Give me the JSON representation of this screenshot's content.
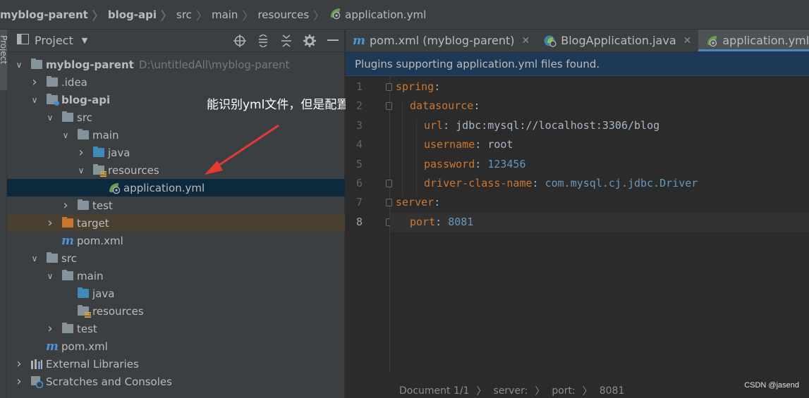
{
  "breadcrumb": [
    "myblog-parent",
    "blog-api",
    "src",
    "main",
    "resources",
    "application.yml"
  ],
  "side_stripe": {
    "label": "Project"
  },
  "project_panel": {
    "title": "Project",
    "tools": [
      "locate-icon",
      "expand-all-icon",
      "collapse-all-icon",
      "settings-icon",
      "hide-icon"
    ]
  },
  "tree": [
    {
      "label": "myblog-parent",
      "path": "D:\\untitledAll\\myblog-parent",
      "bold": true,
      "arrow": "down",
      "icon": "folder",
      "depth": 0
    },
    {
      "label": ".idea",
      "arrow": "right",
      "icon": "folder",
      "depth": 1
    },
    {
      "label": "blog-api",
      "bold": true,
      "arrow": "down",
      "icon": "folder-module",
      "depth": 1
    },
    {
      "label": "src",
      "arrow": "down",
      "icon": "folder",
      "depth": 2
    },
    {
      "label": "main",
      "arrow": "down",
      "icon": "folder",
      "depth": 3
    },
    {
      "label": "java",
      "arrow": "right",
      "icon": "folder-blue",
      "depth": 4
    },
    {
      "label": "resources",
      "arrow": "down",
      "icon": "folder-resources",
      "depth": 4
    },
    {
      "label": "application.yml",
      "arrow": "",
      "icon": "spring",
      "depth": 5,
      "selected": true
    },
    {
      "label": "test",
      "arrow": "right",
      "icon": "folder",
      "depth": 3
    },
    {
      "label": "target",
      "arrow": "right",
      "icon": "folder-orange",
      "depth": 2,
      "excluded": true
    },
    {
      "label": "pom.xml",
      "arrow": "",
      "icon": "maven",
      "depth": 2
    },
    {
      "label": "src",
      "arrow": "down",
      "icon": "folder",
      "depth": 1
    },
    {
      "label": "main",
      "arrow": "down",
      "icon": "folder",
      "depth": 2
    },
    {
      "label": "java",
      "arrow": "",
      "icon": "folder-blue",
      "depth": 3
    },
    {
      "label": "resources",
      "arrow": "",
      "icon": "folder-resources",
      "depth": 3
    },
    {
      "label": "test",
      "arrow": "right",
      "icon": "folder",
      "depth": 2
    },
    {
      "label": "pom.xml",
      "arrow": "",
      "icon": "maven",
      "depth": 1
    },
    {
      "label": "External Libraries",
      "arrow": "right",
      "icon": "libraries",
      "depth": 0
    },
    {
      "label": "Scratches and Consoles",
      "arrow": "right",
      "icon": "scratches",
      "depth": 0
    }
  ],
  "annotation": {
    "text": "能识别yml文件，但是配置不生效"
  },
  "tabs": [
    {
      "label": "pom.xml (myblog-parent)",
      "icon": "maven",
      "active": false
    },
    {
      "label": "BlogApplication.java",
      "icon": "spring-class",
      "active": false
    },
    {
      "label": "application.yml",
      "icon": "spring",
      "active": true
    }
  ],
  "notice": "Plugins supporting application.yml files found.",
  "code": [
    {
      "no": "1",
      "indent": 0,
      "key": "spring",
      "value": "",
      "value_type": ""
    },
    {
      "no": "2",
      "indent": 1,
      "key": "datasource",
      "value": "",
      "value_type": ""
    },
    {
      "no": "3",
      "indent": 2,
      "key": "url",
      "value": "jdbc:mysql://localhost:3306/blog",
      "value_type": "str"
    },
    {
      "no": "4",
      "indent": 2,
      "key": "username",
      "value": "root",
      "value_type": "str"
    },
    {
      "no": "5",
      "indent": 2,
      "key": "password",
      "value": "123456",
      "value_type": "num"
    },
    {
      "no": "6",
      "indent": 2,
      "key": "driver-class-name",
      "value": "com.mysql.cj.jdbc.Driver",
      "value_type": "num"
    },
    {
      "no": "7",
      "indent": 0,
      "key": "server",
      "value": "",
      "value_type": ""
    },
    {
      "no": "8",
      "indent": 1,
      "key": "port",
      "value": "8081",
      "value_type": "num",
      "current": true
    }
  ],
  "status_bar": [
    "Document 1/1",
    "server:",
    "port:",
    "8081"
  ],
  "watermark": "CSDN @jasend",
  "colors": {
    "selection": "#0d293e",
    "key": "#cc7832",
    "number": "#6897bb",
    "notice_bg": "#1e3955",
    "annotation_arrow": "#e53935"
  }
}
